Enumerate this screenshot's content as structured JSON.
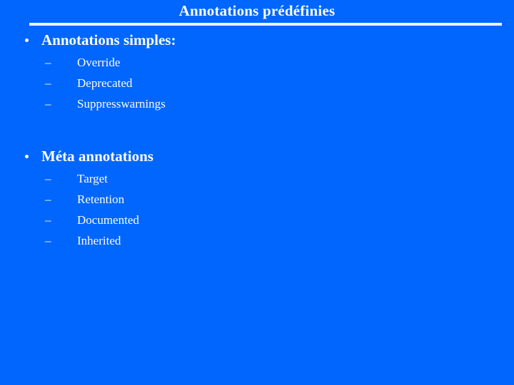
{
  "slide": {
    "title": "Annotations prédéfinies",
    "background_color": "#0066fe",
    "text_color": "#fdfdf5",
    "rule_color": "#e8f4fb",
    "bullet_marker": "•",
    "sub_bullet_marker": "–",
    "groups": [
      {
        "heading": "Annotations simples:",
        "items": [
          {
            "label": "Override"
          },
          {
            "label": "Deprecated"
          },
          {
            "label": "Suppresswarnings"
          }
        ]
      },
      {
        "heading": "Méta annotations",
        "items": [
          {
            "label": "Target"
          },
          {
            "label": "Retention"
          },
          {
            "label": "Documented"
          },
          {
            "label": "Inherited"
          }
        ]
      }
    ]
  }
}
